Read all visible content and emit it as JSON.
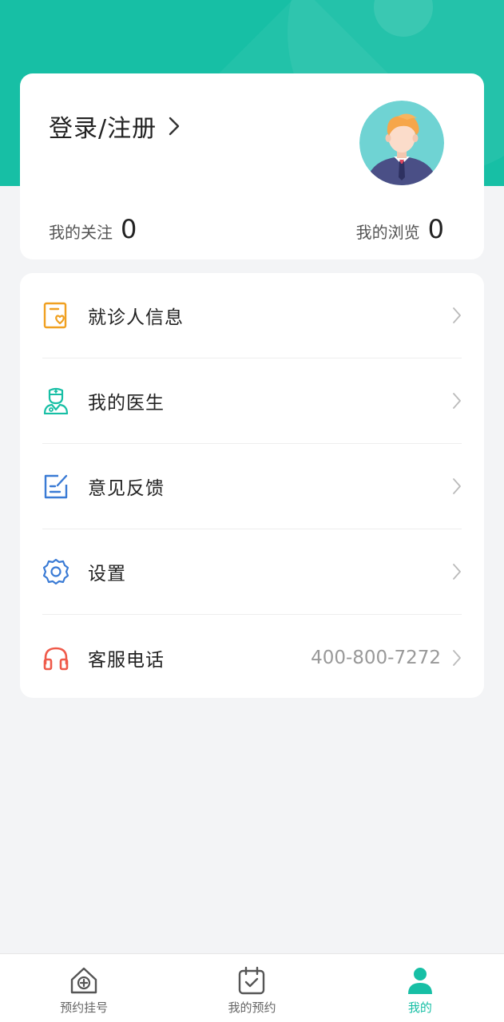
{
  "profile": {
    "login_label": "登录/注册",
    "following_label": "我的关注",
    "following_count": "0",
    "browsing_label": "我的浏览",
    "browsing_count": "0"
  },
  "menu": {
    "items": [
      {
        "label": "就诊人信息",
        "icon": "patient-card-icon",
        "color": "#f0a020"
      },
      {
        "label": "我的医生",
        "icon": "doctor-icon",
        "color": "#17bfa5"
      },
      {
        "label": "意见反馈",
        "icon": "feedback-edit-icon",
        "color": "#3a7bd5"
      },
      {
        "label": "设置",
        "icon": "gear-icon",
        "color": "#3a7bd5"
      },
      {
        "label": "客服电话",
        "icon": "headset-icon",
        "color": "#ef5a4a",
        "value": "400-800-7272"
      }
    ]
  },
  "tabbar": {
    "tabs": [
      {
        "label": "预约挂号",
        "icon": "home-plus-icon",
        "active": false
      },
      {
        "label": "我的预约",
        "icon": "calendar-check-icon",
        "active": false
      },
      {
        "label": "我的",
        "icon": "user-icon",
        "active": true
      }
    ]
  },
  "colors": {
    "accent": "#17bfa5",
    "background": "#f3f4f6",
    "card": "#ffffff"
  }
}
